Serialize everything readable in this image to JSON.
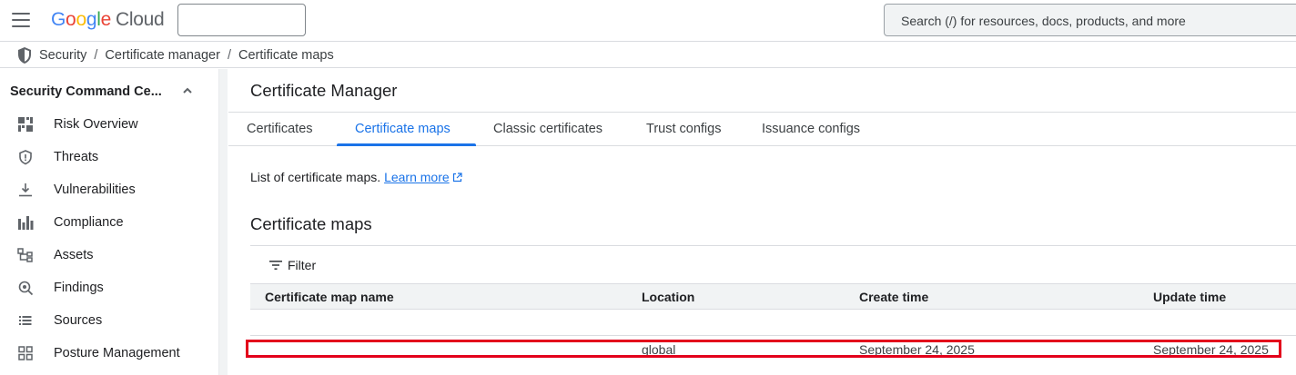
{
  "header": {
    "logo": {
      "letters": [
        "G",
        "o",
        "o",
        "g",
        "l",
        "e"
      ],
      "product": "Cloud"
    },
    "project_picker_value": "",
    "search_placeholder": "Search (/) for resources, docs, products, and more"
  },
  "breadcrumb": [
    "Security",
    "Certificate manager",
    "Certificate maps"
  ],
  "sidebar": {
    "header": "Security Command Ce...",
    "items": [
      {
        "label": "Risk Overview",
        "icon": "dashboard-icon"
      },
      {
        "label": "Threats",
        "icon": "shield-alert-icon"
      },
      {
        "label": "Vulnerabilities",
        "icon": "download-icon"
      },
      {
        "label": "Compliance",
        "icon": "bar-chart-icon"
      },
      {
        "label": "Assets",
        "icon": "hierarchy-icon"
      },
      {
        "label": "Findings",
        "icon": "search-findings-icon"
      },
      {
        "label": "Sources",
        "icon": "list-icon"
      },
      {
        "label": "Posture Management",
        "icon": "grid-icon"
      }
    ]
  },
  "main": {
    "title": "Certificate Manager",
    "tabs": [
      {
        "label": "Certificates"
      },
      {
        "label": "Certificate maps",
        "active": true
      },
      {
        "label": "Classic certificates"
      },
      {
        "label": "Trust configs"
      },
      {
        "label": "Issuance configs"
      }
    ],
    "description": "List of certificate maps.",
    "learn_more": "Learn more",
    "section_title": "Certificate maps",
    "filter_label": "Filter",
    "table": {
      "columns": [
        "Certificate map name",
        "Location",
        "Create time",
        "Update time"
      ],
      "rows": [
        {
          "name": "",
          "location": "global",
          "create_time": "September 24, 2025",
          "update_time": "September 24, 2025"
        }
      ]
    }
  },
  "colors": {
    "accent": "#1a73e8",
    "highlight": "#e3001b"
  }
}
